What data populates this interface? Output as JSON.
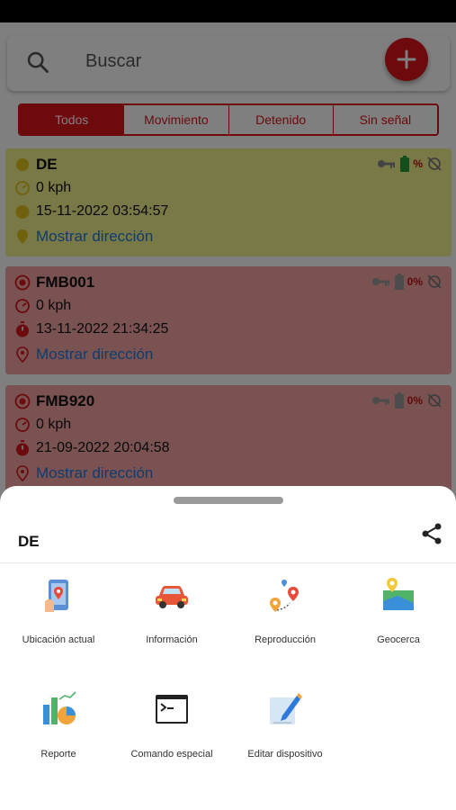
{
  "search": {
    "placeholder": "Buscar"
  },
  "tabs": [
    {
      "label": "Todos",
      "active": true
    },
    {
      "label": "Movimiento",
      "active": false
    },
    {
      "label": "Detenido",
      "active": false
    },
    {
      "label": "Sin señal",
      "active": false
    }
  ],
  "devices": [
    {
      "name": "DE",
      "speed": "0 kph",
      "datetime": "15-11-2022 03:54:57",
      "address_link": "Mostrar dirección",
      "battery_text": "%",
      "status": "yellow"
    },
    {
      "name": "FMB001",
      "speed": "0 kph",
      "datetime": "13-11-2022 21:34:25",
      "address_link": "Mostrar dirección",
      "battery_text": "0%",
      "status": "red"
    },
    {
      "name": "FMB920",
      "speed": "0 kph",
      "datetime": "21-09-2022 20:04:58",
      "address_link": "Mostrar dirección",
      "battery_text": "0%",
      "status": "red"
    }
  ],
  "sheet": {
    "title": "DE",
    "actions": [
      {
        "label": "Ubicación actual",
        "icon": "current-location-icon"
      },
      {
        "label": "Información",
        "icon": "car-info-icon"
      },
      {
        "label": "Reproducción",
        "icon": "route-playback-icon"
      },
      {
        "label": "Geocerca",
        "icon": "geofence-map-icon"
      },
      {
        "label": "Reporte",
        "icon": "report-chart-icon"
      },
      {
        "label": "Comando especial",
        "icon": "terminal-command-icon"
      },
      {
        "label": "Editar dispositivo",
        "icon": "edit-device-icon"
      }
    ]
  },
  "colors": {
    "primary": "#d8141c",
    "card_yellow": "#f3f08e",
    "card_red": "#f5a5a5",
    "link": "#1e78d8"
  }
}
